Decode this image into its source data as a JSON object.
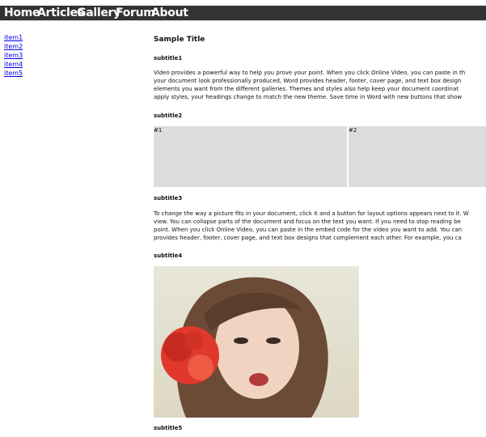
{
  "nav": [
    "Home",
    "Articles",
    "Gallery",
    "Forum",
    "About"
  ],
  "sidebar": [
    "item1",
    "item2",
    "item3",
    "item4",
    "item5"
  ],
  "main": {
    "title": "Sample Title",
    "subtitle1": "subtitle1",
    "para1_lines": [
      "Video provides a powerful way to help you prove your point. When you click Online Video, you can paste in th",
      "your document look professionally produced, Word provides header, footer, cover page, and text box design",
      "elements you want from the different galleries. Themes and styles also help keep your document coordinat",
      "apply styles, your headings change to match the new theme. Save time in Word with new buttons that show"
    ],
    "subtitle2": "subtitle2",
    "boxes": [
      "#1",
      "#2"
    ],
    "subtitle3": "subtitle3",
    "para3_lines": [
      "To change the way a picture fits in your document, click it and a button for layout options appears next to it. W",
      "view. You can collapse parts of the document and focus on the text you want. If you need to stop reading be",
      "point. When you click Online Video, you can paste in the embed code for the video you want to add. You can",
      "provides header, footer, cover page, and text box designs that complement each other. For example, you ca"
    ],
    "subtitle4": "subtitle4",
    "subtitle5": "subtitle5"
  },
  "colors": {
    "topbar": "#333333",
    "link": "#0000ee",
    "box": "#dcdcdc",
    "flower": "#e0382c"
  }
}
